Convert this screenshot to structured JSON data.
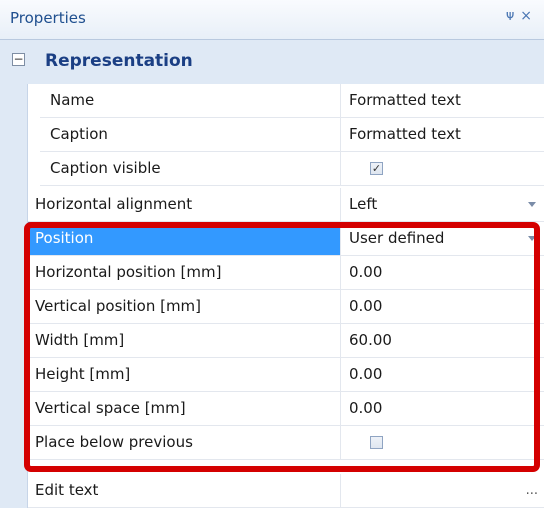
{
  "panel": {
    "title": "Properties",
    "pin_icon": "pin-icon",
    "close_icon": "close-icon",
    "pin_glyph": "ᴪ",
    "close_glyph": "×"
  },
  "category": {
    "label": "Representation",
    "expander_glyph": "−"
  },
  "rows": [
    {
      "name": "Name",
      "value": "Formatted text"
    },
    {
      "name": "Caption",
      "value": "Formatted text"
    },
    {
      "name": "Caption visible",
      "checked": true
    },
    {
      "name": "Horizontal alignment",
      "value": "Left"
    },
    {
      "name": "Position",
      "value": "User defined"
    },
    {
      "name": "Horizontal position [mm]",
      "value": "0.00"
    },
    {
      "name": "Vertical position [mm]",
      "value": "0.00"
    },
    {
      "name": "Width [mm]",
      "value": "60.00"
    },
    {
      "name": "Height [mm]",
      "value": "0.00"
    },
    {
      "name": "Vertical space [mm]",
      "value": "0.00"
    },
    {
      "name": "Place below previous",
      "checked": false
    },
    {
      "name": "Edit text",
      "value": "",
      "ellipsis": "..."
    }
  ],
  "colors": {
    "highlight": "#d40000",
    "selection": "#3399ff",
    "category_text": "#1b3f84"
  }
}
